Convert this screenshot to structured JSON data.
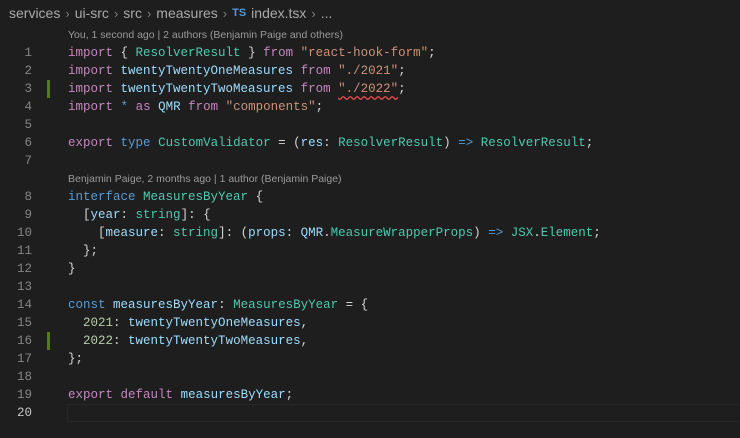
{
  "breadcrumb": {
    "items": [
      "services",
      "ui-src",
      "src",
      "measures"
    ],
    "file_badge": "TS",
    "file_name": "index.tsx",
    "trailing": "..."
  },
  "codelens": {
    "top": "You, 1 second ago | 2 authors (Benjamin Paige and others)",
    "interface": "Benjamin Paige, 2 months ago | 1 author (Benjamin Paige)"
  },
  "current_line": 20,
  "modified_lines": [
    3,
    16
  ],
  "lines": [
    {
      "n": 1,
      "tokens": [
        [
          "kwc",
          "import"
        ],
        [
          "pun",
          " { "
        ],
        [
          "typ",
          "ResolverResult"
        ],
        [
          "pun",
          " } "
        ],
        [
          "kwc",
          "from"
        ],
        [
          "pun",
          " "
        ],
        [
          "str",
          "\"react-hook-form\""
        ],
        [
          "pun",
          ";"
        ]
      ]
    },
    {
      "n": 2,
      "tokens": [
        [
          "kwc",
          "import"
        ],
        [
          "pun",
          " "
        ],
        [
          "var",
          "twentyTwentyOneMeasures"
        ],
        [
          "pun",
          " "
        ],
        [
          "kwc",
          "from"
        ],
        [
          "pun",
          " "
        ],
        [
          "str",
          "\"./2021\""
        ],
        [
          "pun",
          ";"
        ]
      ]
    },
    {
      "n": 3,
      "tokens": [
        [
          "kwc",
          "import"
        ],
        [
          "pun",
          " "
        ],
        [
          "var",
          "twentyTwentyTwoMeasures"
        ],
        [
          "pun",
          " "
        ],
        [
          "kwc",
          "from"
        ],
        [
          "pun",
          " "
        ],
        [
          "str squiggle",
          "\"./2022\""
        ],
        [
          "pun",
          ";"
        ]
      ]
    },
    {
      "n": 4,
      "tokens": [
        [
          "kwc",
          "import"
        ],
        [
          "pun",
          " "
        ],
        [
          "kw",
          "*"
        ],
        [
          "pun",
          " "
        ],
        [
          "kwc",
          "as"
        ],
        [
          "pun",
          " "
        ],
        [
          "var",
          "QMR"
        ],
        [
          "pun",
          " "
        ],
        [
          "kwc",
          "from"
        ],
        [
          "pun",
          " "
        ],
        [
          "str",
          "\"components\""
        ],
        [
          "pun",
          ";"
        ]
      ]
    },
    {
      "n": 5,
      "tokens": []
    },
    {
      "n": 6,
      "tokens": [
        [
          "kwc",
          "export"
        ],
        [
          "pun",
          " "
        ],
        [
          "kw",
          "type"
        ],
        [
          "pun",
          " "
        ],
        [
          "typ",
          "CustomValidator"
        ],
        [
          "pun",
          " = ("
        ],
        [
          "var",
          "res"
        ],
        [
          "pun",
          ": "
        ],
        [
          "typ",
          "ResolverResult"
        ],
        [
          "pun",
          ") "
        ],
        [
          "kw",
          "=>"
        ],
        [
          "pun",
          " "
        ],
        [
          "typ",
          "ResolverResult"
        ],
        [
          "pun",
          ";"
        ]
      ]
    },
    {
      "n": 7,
      "tokens": [],
      "lens_after": "interface"
    },
    {
      "n": 8,
      "tokens": [
        [
          "kw",
          "interface"
        ],
        [
          "pun",
          " "
        ],
        [
          "typ",
          "MeasuresByYear"
        ],
        [
          "pun",
          " {"
        ]
      ]
    },
    {
      "n": 9,
      "tokens": [
        [
          "pun",
          "  ["
        ],
        [
          "var",
          "year"
        ],
        [
          "pun",
          ": "
        ],
        [
          "typ",
          "string"
        ],
        [
          "pun",
          "]: {"
        ]
      ]
    },
    {
      "n": 10,
      "tokens": [
        [
          "pun",
          "    ["
        ],
        [
          "var",
          "measure"
        ],
        [
          "pun",
          ": "
        ],
        [
          "typ",
          "string"
        ],
        [
          "pun",
          "]: ("
        ],
        [
          "var",
          "props"
        ],
        [
          "pun",
          ": "
        ],
        [
          "var",
          "QMR"
        ],
        [
          "pun",
          "."
        ],
        [
          "typ",
          "MeasureWrapperProps"
        ],
        [
          "pun",
          ") "
        ],
        [
          "kw",
          "=>"
        ],
        [
          "pun",
          " "
        ],
        [
          "typ",
          "JSX"
        ],
        [
          "pun",
          "."
        ],
        [
          "typ",
          "Element"
        ],
        [
          "pun",
          ";"
        ]
      ]
    },
    {
      "n": 11,
      "tokens": [
        [
          "pun",
          "  };"
        ]
      ]
    },
    {
      "n": 12,
      "tokens": [
        [
          "pun",
          "}"
        ]
      ]
    },
    {
      "n": 13,
      "tokens": []
    },
    {
      "n": 14,
      "tokens": [
        [
          "kw",
          "const"
        ],
        [
          "pun",
          " "
        ],
        [
          "var",
          "measuresByYear"
        ],
        [
          "pun",
          ": "
        ],
        [
          "typ",
          "MeasuresByYear"
        ],
        [
          "pun",
          " = {"
        ]
      ]
    },
    {
      "n": 15,
      "tokens": [
        [
          "pun",
          "  "
        ],
        [
          "num",
          "2021"
        ],
        [
          "pun",
          ": "
        ],
        [
          "var",
          "twentyTwentyOneMeasures"
        ],
        [
          "pun",
          ","
        ]
      ]
    },
    {
      "n": 16,
      "tokens": [
        [
          "pun",
          "  "
        ],
        [
          "num",
          "2022"
        ],
        [
          "pun",
          ": "
        ],
        [
          "var",
          "twentyTwentyTwoMeasures"
        ],
        [
          "pun",
          ","
        ]
      ]
    },
    {
      "n": 17,
      "tokens": [
        [
          "pun",
          "};"
        ]
      ]
    },
    {
      "n": 18,
      "tokens": []
    },
    {
      "n": 19,
      "tokens": [
        [
          "kwc",
          "export"
        ],
        [
          "pun",
          " "
        ],
        [
          "kwc",
          "default"
        ],
        [
          "pun",
          " "
        ],
        [
          "var",
          "measuresByYear"
        ],
        [
          "pun",
          ";"
        ]
      ]
    },
    {
      "n": 20,
      "tokens": []
    }
  ]
}
